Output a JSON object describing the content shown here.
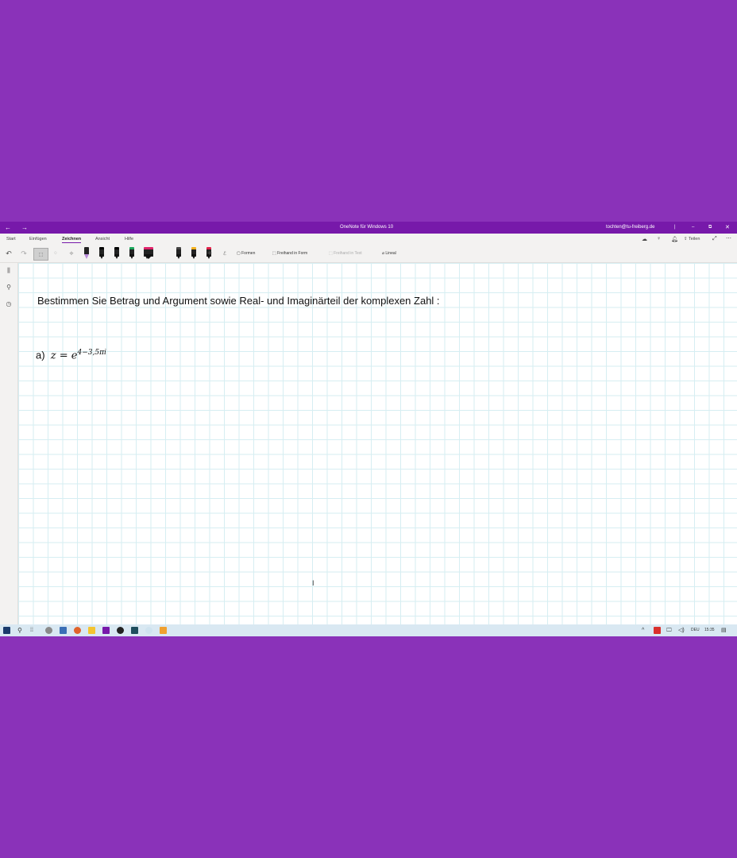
{
  "window": {
    "title": "OneNote für Windows 10",
    "account": "tochten@tu-freiberg.de",
    "back_icon": "arrow-left-icon",
    "forward_icon": "arrow-right-icon"
  },
  "ribbon": {
    "tabs": [
      {
        "label": "Start"
      },
      {
        "label": "Einfügen"
      },
      {
        "label": "Zeichnen"
      },
      {
        "label": "Ansicht"
      },
      {
        "label": "Hilfe"
      }
    ],
    "active_tab": "Zeichnen",
    "share_label": "Teilen",
    "buttons": {
      "shapes": "Formen",
      "ink_to_shape": "Freihand in Form",
      "ink_to_text": "Freihand in Text",
      "ruler": "Lineal"
    },
    "pen_colors": [
      "#000000",
      "#000000",
      "#1aa55a",
      "#1e8fd6",
      "#e0226b",
      "#444444",
      "#f2b01e",
      "#e3224a"
    ]
  },
  "page": {
    "heading": "Bestimmen Sie Betrag und Argument sowie Real- und Imaginärteil der komplexen Zahl  :",
    "item_label": "a)",
    "equation_lhs": "z = e",
    "equation_exponent": "4−3,5πi"
  },
  "taskbar": {
    "language": "DEU",
    "time": "15:35"
  },
  "colors": {
    "background": "#8a32b9",
    "titlebar": "#7719aa",
    "taskbar": "#d9e8f2"
  }
}
